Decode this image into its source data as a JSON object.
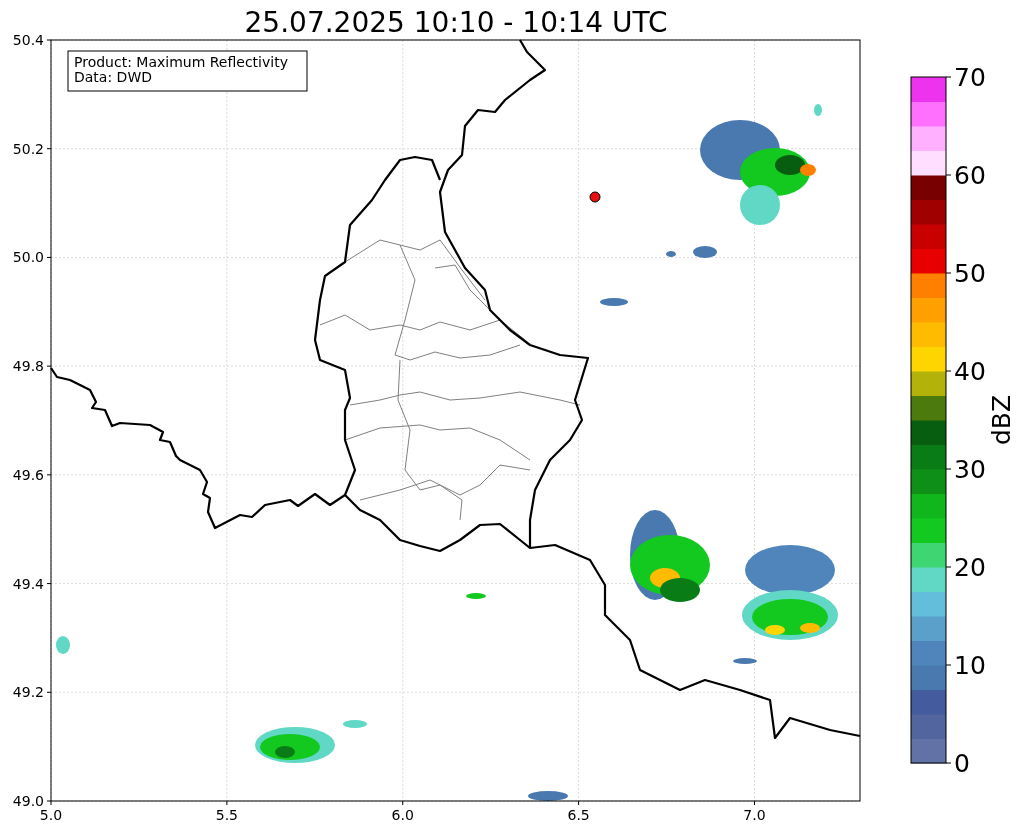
{
  "title": "25.07.2025 10:10 - 10:14 UTC",
  "info_box": [
    "Product: Maximum Reflectivity",
    "Data: DWD"
  ],
  "x_axis": {
    "ticks": [
      "5.0",
      "5.5",
      "6.0",
      "6.5",
      "7.0"
    ]
  },
  "y_axis": {
    "ticks": [
      "50.4",
      "50.2",
      "50.0",
      "49.8",
      "49.6",
      "49.4",
      "49.2",
      "49.0"
    ]
  },
  "colorbar": {
    "label": "dBZ",
    "ticks": [
      "70",
      "60",
      "50",
      "40",
      "30",
      "20",
      "10",
      "0"
    ],
    "bands": [
      {
        "color": "#6272a6"
      },
      {
        "color": "#53659f"
      },
      {
        "color": "#445b9e"
      },
      {
        "color": "#4a79b0"
      },
      {
        "color": "#4f85bb"
      },
      {
        "color": "#5aa0ca"
      },
      {
        "color": "#62bedb"
      },
      {
        "color": "#60d8c5"
      },
      {
        "color": "#3ed672"
      },
      {
        "color": "#13c81f"
      },
      {
        "color": "#11b61d"
      },
      {
        "color": "#0e9018"
      },
      {
        "color": "#0a7c16"
      },
      {
        "color": "#085e10"
      },
      {
        "color": "#4c7a0c"
      },
      {
        "color": "#b2b20a"
      },
      {
        "color": "#ffd500"
      },
      {
        "color": "#ffbb00"
      },
      {
        "color": "#ffa000"
      },
      {
        "color": "#ff8000"
      },
      {
        "color": "#e80000"
      },
      {
        "color": "#c80000"
      },
      {
        "color": "#a00000"
      },
      {
        "color": "#780000"
      },
      {
        "color": "#ffdeff"
      },
      {
        "color": "#ffb0ff"
      },
      {
        "color": "#ff70ff"
      },
      {
        "color": "#ee33ee"
      }
    ]
  }
}
